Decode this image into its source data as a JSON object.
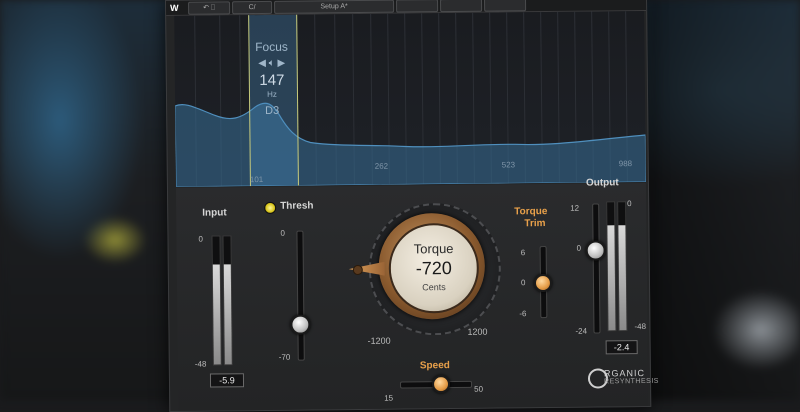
{
  "toolbar": {
    "undo_icon": "undo-icon",
    "compare_label": "C/",
    "preset_label": "Setup A*",
    "logo": "W"
  },
  "analyzer": {
    "focus_label": "Focus",
    "focus_value": "147",
    "focus_unit": "Hz",
    "focus_note": "D3",
    "freq_labels": [
      "101",
      "262",
      "523",
      "988"
    ]
  },
  "input": {
    "label": "Input",
    "scale_top": "0",
    "scale_bottom": "-48",
    "readout": "-5.9",
    "level_fraction": 0.78
  },
  "thresh": {
    "label": "Thresh",
    "scale_top": "0",
    "scale_bottom": "-70",
    "value_fraction": 0.72
  },
  "torque": {
    "label": "Torque",
    "value": "-720",
    "unit": "Cents",
    "min_label": "-1200",
    "max_label": "1200",
    "accent_color": "#b97a45"
  },
  "torque_trim": {
    "label_line1": "Torque",
    "label_line2": "Trim",
    "scale_top": "6",
    "scale_mid": "0",
    "scale_bottom": "-6",
    "value_fraction": 0.5
  },
  "output": {
    "label": "Output",
    "scale_left_top": "12",
    "scale_left_mid": "0",
    "scale_left_bottom": "-24",
    "scale_right_top": "0",
    "scale_right_bottom": "-48",
    "readout": "-2.4",
    "level_fraction": 0.82
  },
  "speed": {
    "label": "Speed",
    "min_label": "15",
    "max_label": "50"
  },
  "brand": {
    "line1": "RGANIC",
    "line2": "RESYNTHESIS",
    "logo_letter": "O"
  },
  "colors": {
    "accent_orange": "#e8a04a",
    "focus_blue": "#4a8cbe",
    "led_yellow": "#d7c41b"
  }
}
